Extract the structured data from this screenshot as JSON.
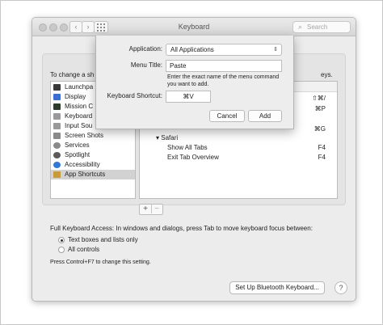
{
  "window": {
    "title": "Keyboard",
    "search_placeholder": "Search",
    "nav_back": "‹",
    "nav_forward": "›"
  },
  "instructions": {
    "left": "To change a sh",
    "right": "eys."
  },
  "categories": [
    {
      "label": "Launchpa",
      "icon": "launchpad-icon",
      "color": "#3a3a3a"
    },
    {
      "label": "Display",
      "icon": "display-icon",
      "color": "#3b6fd6"
    },
    {
      "label": "Mission C",
      "icon": "mission-control-icon",
      "color": "#2c3d2c"
    },
    {
      "label": "Keyboard",
      "icon": "keyboard-icon",
      "color": "#9a9a9a"
    },
    {
      "label": "Input Sou",
      "icon": "input-sources-icon",
      "color": "#9a9a9a"
    },
    {
      "label": "Screen Shots",
      "icon": "screenshot-icon",
      "color": "#8a8a8a"
    },
    {
      "label": "Services",
      "icon": "gear-icon",
      "color": "#8a8a8a"
    },
    {
      "label": "Spotlight",
      "icon": "spotlight-icon",
      "color": "#5a5a5a"
    },
    {
      "label": "Accessibility",
      "icon": "accessibility-icon",
      "color": "#2f7ad8"
    },
    {
      "label": "App Shortcuts",
      "icon": "app-shortcuts-icon",
      "color": "#c89a3a"
    }
  ],
  "shortcuts_partial_keys": [
    "⇧⌘/",
    "⌘P",
    "⌘G"
  ],
  "safari_group": {
    "label": "Safari",
    "items": [
      {
        "name": "Show All Tabs",
        "key": "F4"
      },
      {
        "name": "Exit Tab Overview",
        "key": "F4"
      }
    ]
  },
  "list_controls": {
    "plus": "+",
    "minus": "−"
  },
  "full_keyboard_access": {
    "label": "Full Keyboard Access: In windows and dialogs, press Tab to move keyboard focus between:",
    "options": [
      {
        "label": "Text boxes and lists only",
        "selected": true
      },
      {
        "label": "All controls",
        "selected": false
      }
    ],
    "hint": "Press Control+F7 to change this setting."
  },
  "bluetooth_button": "Set Up Bluetooth Keyboard...",
  "help_button": "?",
  "sheet": {
    "application_label": "Application:",
    "application_value": "All Applications",
    "menu_title_label": "Menu Title:",
    "menu_title_value": "Paste",
    "menu_title_help": "Enter the exact name of the menu command you want to add.",
    "shortcut_label": "Keyboard Shortcut:",
    "shortcut_value": "⌘V",
    "cancel_label": "Cancel",
    "add_label": "Add"
  }
}
